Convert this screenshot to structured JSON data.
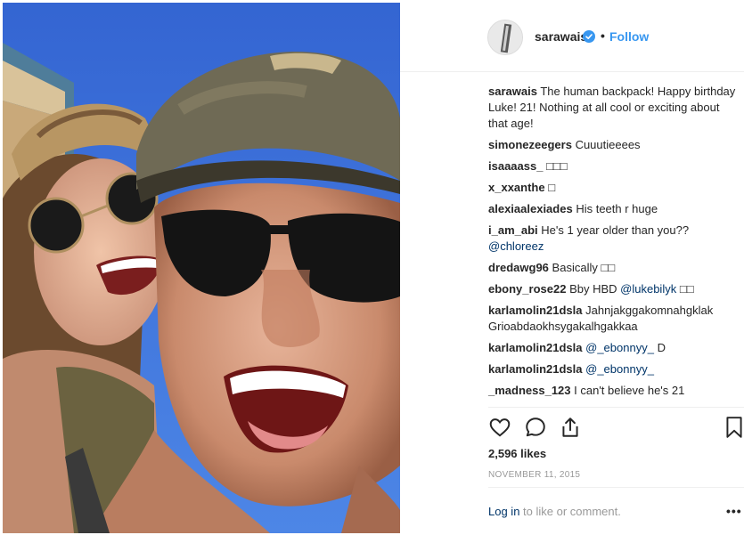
{
  "post": {
    "owner": "sarawais",
    "separator": "•",
    "follow_label": "Follow",
    "comments": [
      {
        "user": "sarawais",
        "text": "The human backpack! Happy birthday Luke! 21! Nothing at all cool or exciting about that age!"
      },
      {
        "user": "simonezeegers",
        "text": "Cuuutieeees"
      },
      {
        "user": "isaaaass_",
        "text": "□□□"
      },
      {
        "user": "x_xxanthe",
        "text": "□"
      },
      {
        "user": "alexiaalexiades",
        "text": "His teeth r huge"
      },
      {
        "user": "i_am_abi",
        "text": "He's 1 year older than you??",
        "mention": "@chloreez"
      },
      {
        "user": "dredawg96",
        "text": "Basically □□"
      },
      {
        "user": "ebony_rose22",
        "text": "Bby HBD",
        "mention": "@lukebilyk",
        "after": "□□"
      },
      {
        "user": "karlamolin21dsla",
        "text": "Jahnjakggakomnahgklak Grioabdaokhsygakalhgakkaa"
      },
      {
        "user": "karlamolin21dsla",
        "mention": "@_ebonnyy_",
        "after": "D"
      },
      {
        "user": "karlamolin21dsla",
        "mention": "@_ebonnyy_"
      },
      {
        "user": "_madness_123",
        "text": "I can't believe he's 21"
      }
    ],
    "likes": "2,596 likes",
    "date": "NOVEMBER 11, 2015",
    "login_link": "Log in",
    "login_rest": " to like or comment.",
    "more": "•••"
  },
  "icons": {
    "verified": "verified-badge-icon",
    "like": "heart-icon",
    "comment": "comment-bubble-icon",
    "share": "share-icon",
    "save": "bookmark-icon"
  },
  "colors": {
    "link_blue": "#3897f0",
    "mention_blue": "#003569",
    "muted_gray": "#999999",
    "text": "#262626"
  }
}
